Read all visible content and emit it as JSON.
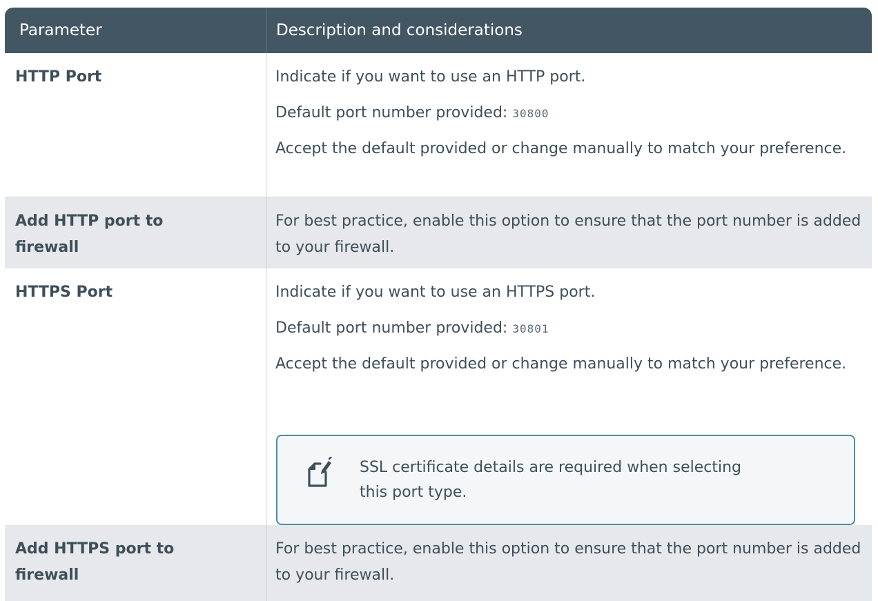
{
  "table": {
    "headers": {
      "parameter": "Parameter",
      "description": "Description and considerations"
    },
    "rows": [
      {
        "parameter": "HTTP Port",
        "lines": [
          "Indicate if you want to use an HTTP port.",
          "Default port number provided: ",
          "Accept the default provided or change manually to match your preference."
        ],
        "port_value": "30800"
      },
      {
        "parameter": "Add HTTP port to firewall",
        "lines": [
          "For best practice, enable this option to ensure that the port number is added to your firewall."
        ]
      },
      {
        "parameter": "HTTPS Port",
        "lines": [
          "Indicate if you want to use an HTTPS port.",
          "Default port number provided: ",
          "Accept the default provided or change manually to match your preference."
        ],
        "port_value": "30801",
        "note": {
          "icon": "note-pencil-icon",
          "text": "SSL certificate details are required when selecting this port type."
        }
      },
      {
        "parameter": "Add HTTPS port to firewall",
        "lines": [
          "For best practice, enable this option to ensure that the port number is added to your firewall."
        ]
      }
    ]
  },
  "colors": {
    "header_bg": "#435663",
    "header_text": "#ffffff",
    "grey_row": "#e6e8eb",
    "note_border": "#4a8fa5",
    "text": "#3f4f5a"
  }
}
